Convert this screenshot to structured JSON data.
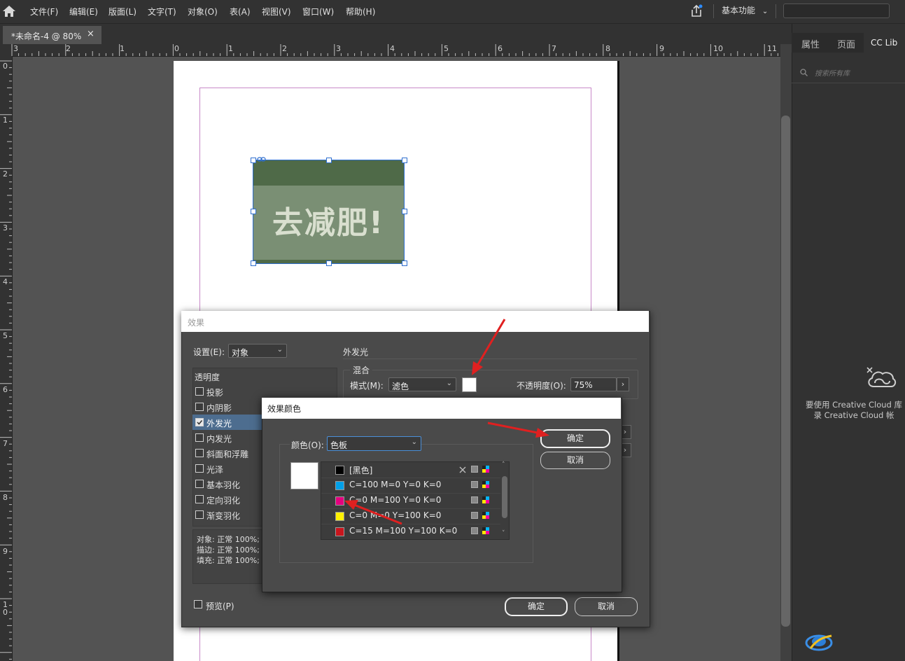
{
  "menubar": {
    "items": [
      "文件(F)",
      "编辑(E)",
      "版面(L)",
      "文字(T)",
      "对象(O)",
      "表(A)",
      "视图(V)",
      "窗口(W)",
      "帮助(H)"
    ],
    "workspace": "基本功能"
  },
  "document": {
    "tab_label": "*未命名-4 @ 80%",
    "close_glyph": "×",
    "image_text": "去减肥!"
  },
  "rulers": {
    "horizontal": [
      "3",
      "2",
      "1",
      "0",
      "1",
      "2",
      "3",
      "4",
      "5",
      "6",
      "7",
      "8",
      "9",
      "10",
      "11"
    ],
    "vertical": [
      "0",
      "1",
      "2",
      "3",
      "4",
      "5",
      "6",
      "7",
      "8",
      "9",
      "1\n0"
    ]
  },
  "right_panel": {
    "tabs": [
      "属性",
      "页面",
      "CC Lib"
    ],
    "search_placeholder": "搜索所有库",
    "message_line1": "要使用 Creative Cloud 库",
    "message_line2": "录 Creative Cloud 帐"
  },
  "effects_dialog": {
    "title": "效果",
    "settings_label": "设置(E):",
    "settings_value": "对象",
    "section_title": "外发光",
    "list_header": "透明度",
    "effects": [
      {
        "label": "投影",
        "checked": false
      },
      {
        "label": "内阴影",
        "checked": false
      },
      {
        "label": "外发光",
        "checked": true
      },
      {
        "label": "内发光",
        "checked": false
      },
      {
        "label": "斜面和浮雕",
        "checked": false
      },
      {
        "label": "光泽",
        "checked": false
      },
      {
        "label": "基本羽化",
        "checked": false
      },
      {
        "label": "定向羽化",
        "checked": false
      },
      {
        "label": "渐变羽化",
        "checked": false
      }
    ],
    "summary": [
      "对象: 正常 100%; 外",
      "描边: 正常 100%;",
      "填充: 正常 100%;"
    ],
    "blend_legend": "混合",
    "mode_label": "模式(M):",
    "mode_value": "滤色",
    "opacity_label": "不透明度(O):",
    "opacity_value": "75%",
    "preview_label": "预览(P)",
    "ok": "确定",
    "cancel": "取消",
    "swatch_color": "#ffffff"
  },
  "effect_color_dialog": {
    "title": "效果颜色",
    "color_label": "颜色(O):",
    "color_value": "色板",
    "ok": "确定",
    "cancel": "取消",
    "swatches": [
      {
        "name": "[黑色]",
        "color": "#000000"
      },
      {
        "name": "C=100 M=0 Y=0 K=0",
        "color": "#00a0e9"
      },
      {
        "name": "C=0 M=100 Y=0 K=0",
        "color": "#e4007f"
      },
      {
        "name": "C=0 M=0 Y=100 K=0",
        "color": "#fff100"
      },
      {
        "name": "C=15 M=100 Y=100 K=0",
        "color": "#c9161d"
      }
    ]
  },
  "colors": {
    "accent_red": "#e02020",
    "selection_blue": "#2f6fcf"
  }
}
